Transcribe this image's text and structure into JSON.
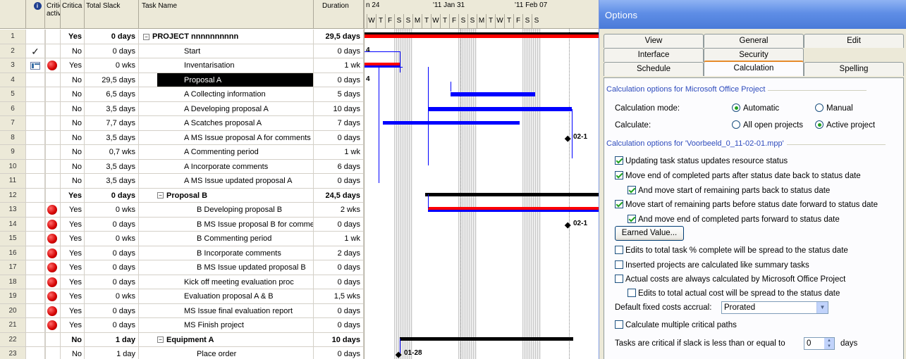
{
  "grid": {
    "headers": {
      "id": "",
      "indicators": "ℹ",
      "critical_activity": "Critica activity",
      "critical": "Critica",
      "total_slack": "Total Slack",
      "task_name": "Task Name",
      "duration": "Duration"
    },
    "rows": [
      {
        "id": "1",
        "critical": "Yes",
        "slack": "0 days",
        "name": "PROJECT nnnnnnnnnn",
        "duration": "29,5 days",
        "bold": true,
        "summary": true,
        "level": 1,
        "indicator": "",
        "dot": false
      },
      {
        "id": "2",
        "critical": "No",
        "slack": "0 days",
        "name": "Start",
        "duration": "0 days",
        "bold": false,
        "summary": false,
        "level": 2,
        "indicator": "check-icon",
        "dot": false
      },
      {
        "id": "3",
        "critical": "Yes",
        "slack": "0 wks",
        "name": "Inventarisation",
        "duration": "1 wk",
        "bold": false,
        "summary": false,
        "level": 2,
        "indicator": "calendar-icon",
        "dot": true
      },
      {
        "id": "4",
        "critical": "No",
        "slack": "29,5 days",
        "name": "Proposal A",
        "duration": "0 days",
        "bold": false,
        "summary": false,
        "level": 2,
        "indicator": "",
        "dot": false,
        "selected": true
      },
      {
        "id": "5",
        "critical": "No",
        "slack": "6,5 days",
        "name": "A Collecting information",
        "duration": "5 days",
        "bold": false,
        "summary": false,
        "level": 2,
        "indicator": "",
        "dot": false
      },
      {
        "id": "6",
        "critical": "No",
        "slack": "3,5 days",
        "name": "A Developing proposal A",
        "duration": "10 days",
        "bold": false,
        "summary": false,
        "level": 2,
        "indicator": "",
        "dot": false
      },
      {
        "id": "7",
        "critical": "No",
        "slack": "7,7 days",
        "name": "A Scatches proposal A",
        "duration": "7 days",
        "bold": false,
        "summary": false,
        "level": 2,
        "indicator": "",
        "dot": false
      },
      {
        "id": "8",
        "critical": "No",
        "slack": "3,5 days",
        "name": "A MS Issue proposal A for comments",
        "duration": "0 days",
        "bold": false,
        "summary": false,
        "level": 2,
        "indicator": "",
        "dot": false
      },
      {
        "id": "9",
        "critical": "No",
        "slack": "0,7 wks",
        "name": "A Commenting period",
        "duration": "1 wk",
        "bold": false,
        "summary": false,
        "level": 2,
        "indicator": "",
        "dot": false
      },
      {
        "id": "10",
        "critical": "No",
        "slack": "3,5 days",
        "name": "A Incorporate comments",
        "duration": "6 days",
        "bold": false,
        "summary": false,
        "level": 2,
        "indicator": "",
        "dot": false
      },
      {
        "id": "11",
        "critical": "No",
        "slack": "3,5 days",
        "name": "A MS Issue updated proposal A",
        "duration": "0 days",
        "bold": false,
        "summary": false,
        "level": 2,
        "indicator": "",
        "dot": false
      },
      {
        "id": "12",
        "critical": "Yes",
        "slack": "0 days",
        "name": "Proposal B",
        "duration": "24,5 days",
        "bold": true,
        "summary": true,
        "level": 2,
        "indicator": "",
        "dot": false
      },
      {
        "id": "13",
        "critical": "Yes",
        "slack": "0 wks",
        "name": "B Developing proposal B",
        "duration": "2 wks",
        "bold": false,
        "summary": false,
        "level": 3,
        "indicator": "",
        "dot": true
      },
      {
        "id": "14",
        "critical": "Yes",
        "slack": "0 days",
        "name": "B MS Issue proposal B for comments",
        "duration": "0 days",
        "bold": false,
        "summary": false,
        "level": 3,
        "indicator": "",
        "dot": true
      },
      {
        "id": "15",
        "critical": "Yes",
        "slack": "0 wks",
        "name": "B Commenting period",
        "duration": "1 wk",
        "bold": false,
        "summary": false,
        "level": 3,
        "indicator": "",
        "dot": true
      },
      {
        "id": "16",
        "critical": "Yes",
        "slack": "0 days",
        "name": "B Incorporate comments",
        "duration": "2 days",
        "bold": false,
        "summary": false,
        "level": 3,
        "indicator": "",
        "dot": true
      },
      {
        "id": "17",
        "critical": "Yes",
        "slack": "0 days",
        "name": "B MS Issue updated proposal B",
        "duration": "0 days",
        "bold": false,
        "summary": false,
        "level": 3,
        "indicator": "",
        "dot": true
      },
      {
        "id": "18",
        "critical": "Yes",
        "slack": "0 days",
        "name": "Kick off meeting evaluation proc",
        "duration": "0 days",
        "bold": false,
        "summary": false,
        "level": 2,
        "indicator": "",
        "dot": true
      },
      {
        "id": "19",
        "critical": "Yes",
        "slack": "0 wks",
        "name": "Evaluation proposal A & B",
        "duration": "1,5 wks",
        "bold": false,
        "summary": false,
        "level": 2,
        "indicator": "",
        "dot": true
      },
      {
        "id": "20",
        "critical": "Yes",
        "slack": "0 days",
        "name": "MS Issue  final evaluation report",
        "duration": "0 days",
        "bold": false,
        "summary": false,
        "level": 2,
        "indicator": "",
        "dot": true
      },
      {
        "id": "21",
        "critical": "Yes",
        "slack": "0 days",
        "name": "MS Finish project",
        "duration": "0 days",
        "bold": false,
        "summary": false,
        "level": 2,
        "indicator": "",
        "dot": true
      },
      {
        "id": "22",
        "critical": "No",
        "slack": "1 day",
        "name": "Equipment A",
        "duration": "10 days",
        "bold": true,
        "summary": true,
        "level": 2,
        "indicator": "",
        "dot": false
      },
      {
        "id": "23",
        "critical": "No",
        "slack": "1 day",
        "name": "Place order",
        "duration": "0 days",
        "bold": false,
        "summary": false,
        "level": 3,
        "indicator": "",
        "dot": false
      }
    ]
  },
  "gantt": {
    "weeks": [
      "n 24",
      "'11 Jan 31",
      "'11 Feb 07"
    ],
    "days": [
      "W",
      "T",
      "F",
      "S",
      "S",
      "M",
      "T",
      "W",
      "T",
      "F",
      "S",
      "S",
      "M",
      "T",
      "W",
      "T",
      "F",
      "S",
      "S"
    ],
    "milestone_labels": {
      "row1": "4",
      "row3": "4",
      "row8": "02-1",
      "row14": "02-1",
      "row23": "01-28"
    },
    "colors": {
      "task": "#0000ff",
      "critical": "#ff0000",
      "summary": "#000000",
      "link": "#0000ff"
    }
  },
  "dialog": {
    "title": "Options",
    "tabs": [
      {
        "label": "View"
      },
      {
        "label": "General"
      },
      {
        "label": "Edit"
      },
      {
        "label": "Interface"
      },
      {
        "label": "Security"
      },
      {
        "label": "Schedule"
      },
      {
        "label": "Calculation",
        "active": true
      },
      {
        "label": "Spelling"
      }
    ],
    "section1": "Calculation options for Microsoft Office Project",
    "calc_mode_label": "Calculation mode:",
    "calc_mode_options": [
      "Automatic",
      "Manual"
    ],
    "calc_mode_selected": "Automatic",
    "calculate_label": "Calculate:",
    "calculate_options": [
      "All open projects",
      "Active project"
    ],
    "calculate_selected": "Active project",
    "section2": "Calculation options for 'Voorbeeld_0_11-02-01.mpp'",
    "checks": [
      {
        "label": "Updating task status updates resource status",
        "checked": true
      },
      {
        "label": "Move end of completed parts after status date back to status date",
        "checked": true
      },
      {
        "label": "And move start of remaining parts back to status date",
        "checked": true
      },
      {
        "label": "Move start of remaining parts before status date forward to status date",
        "checked": true
      },
      {
        "label": "And move end of completed parts forward to status date",
        "checked": true
      }
    ],
    "earned_value_button": "Earned Value...",
    "checks2": [
      {
        "label": "Edits to total task % complete will be spread to the status date",
        "checked": false
      },
      {
        "label": "Inserted projects are calculated like summary tasks",
        "checked": false
      },
      {
        "label": "Actual costs are always calculated by Microsoft Office Project",
        "checked": false
      },
      {
        "label": "Edits to total actual cost will be spread to the status date",
        "checked": false
      }
    ],
    "fixed_costs_label": "Default fixed costs accrual:",
    "fixed_costs_value": "Prorated",
    "multiple_paths_label": "Calculate multiple critical paths",
    "multiple_paths_checked": false,
    "slack_label": "Tasks are critical if slack is less than or equal to",
    "slack_value": "0",
    "slack_unit": "days"
  }
}
